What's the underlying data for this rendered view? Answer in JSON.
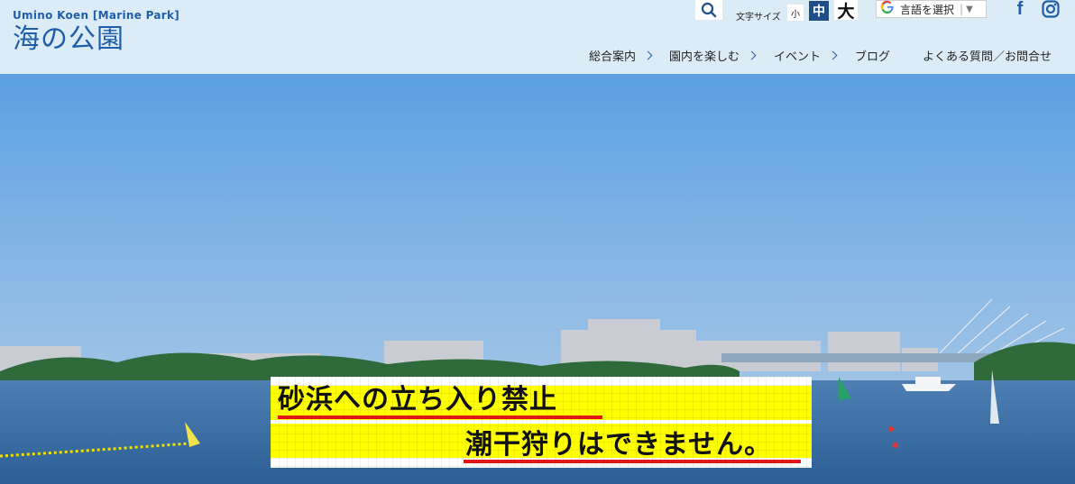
{
  "header": {
    "logo_en": "Umino Koen [Marine Park]",
    "logo_jp": "海の公園",
    "font_size_label": "文字サイズ",
    "font_size_small": "小",
    "font_size_medium": "中",
    "font_size_large": "大",
    "translate_label": "言語を選択",
    "translate_separator": "|",
    "translate_arrow": "▼",
    "facebook_glyph": "f"
  },
  "nav": {
    "items": [
      {
        "label": "総合案内"
      },
      {
        "label": "園内を楽しむ"
      },
      {
        "label": "イベント"
      },
      {
        "label": "ブログ"
      },
      {
        "label": "よくある質問／お問合せ"
      }
    ]
  },
  "hero": {
    "notice_line1": "砂浜への立ち入り禁止",
    "notice_line2": "潮干狩りはできません。"
  },
  "colors": {
    "brand": "#1f5ea8",
    "header_bg": "#dcecf7",
    "highlight": "#ffff00",
    "underline": "#e0161b"
  }
}
